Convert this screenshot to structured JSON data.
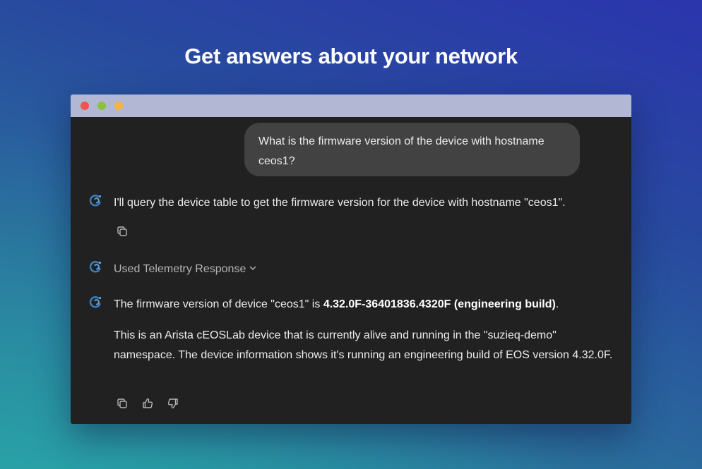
{
  "hero": {
    "title": "Get answers about your network"
  },
  "window": {
    "controls": [
      "close",
      "minimize",
      "maximize"
    ]
  },
  "chat": {
    "user_message": "What is the firmware version of the device with hostname ceos1?",
    "assistant_1": "I'll query the device table to get the firmware version for the device with hostname \"ceos1\".",
    "tool_toggle_label": "Used Telemetry Response",
    "answer_prefix": "The firmware version of device \"ceos1\" is ",
    "answer_bold": "4.32.0F-36401836.4320F (engineering build)",
    "answer_suffix": ".",
    "answer_detail": "This is an Arista cEOSLab device that is currently alive and running in the \"suzieq-demo\" namespace. The device information shows it's running an engineering build of EOS version 4.32.0F.",
    "icons": {
      "assistant": "assistant-logo-icon",
      "copy": "copy-icon",
      "thumbs_up": "thumbs-up-icon",
      "thumbs_down": "thumbs-down-icon",
      "chevron": "chevron-down-icon"
    },
    "colors": {
      "assistant_icon": "#3b82c4",
      "window_bg": "#212121",
      "user_bubble": "#424242",
      "titlebar": "#b2b8d4"
    }
  }
}
